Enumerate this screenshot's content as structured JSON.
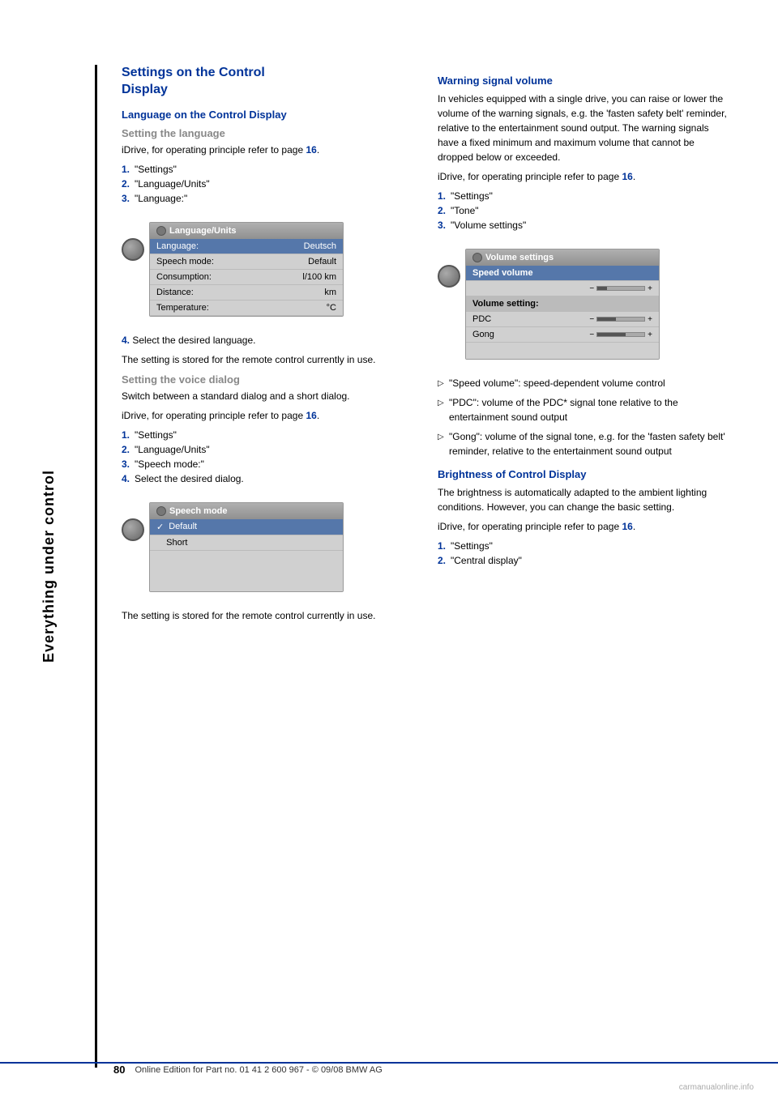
{
  "sidebar": {
    "text": "Everything under control"
  },
  "left_column": {
    "section_title_line1": "Settings on the Control",
    "section_title_line2": "Display",
    "subsection_language": "Language on the Control Display",
    "sub_setting_language": "Setting the language",
    "idrive_ref_1": "iDrive, for operating principle refer to page ",
    "idrive_ref_page_1": "16",
    "idrive_ref_1_suffix": ".",
    "language_steps": [
      {
        "num": "1.",
        "text": "\"Settings\""
      },
      {
        "num": "2.",
        "text": "\"Language/Units\""
      },
      {
        "num": "3.",
        "text": "\"Language:\""
      }
    ],
    "step4_text": "Select the desired language.",
    "setting_stored_text": "The setting is stored for the remote control currently in use.",
    "subsection_voice": "Setting the voice dialog",
    "voice_intro": "Switch between a standard dialog and a short dialog.",
    "idrive_ref_2": "iDrive, for operating principle refer to page ",
    "idrive_ref_page_2": "16",
    "idrive_ref_2_suffix": ".",
    "voice_steps": [
      {
        "num": "1.",
        "text": "\"Settings\""
      },
      {
        "num": "2.",
        "text": "\"Language/Units\""
      },
      {
        "num": "3.",
        "text": "\"Speech mode:\""
      },
      {
        "num": "4.",
        "text": "Select the desired dialog."
      }
    ],
    "setting_stored_text2": "The setting is stored for the remote control currently in use.",
    "language_screen": {
      "title": "Language/Units",
      "rows": [
        {
          "label": "Language:",
          "value": "Deutsch",
          "highlighted": true
        },
        {
          "label": "Speech mode:",
          "value": "Default",
          "highlighted": false
        },
        {
          "label": "Consumption:",
          "value": "l/100 km",
          "highlighted": false
        },
        {
          "label": "Distance:",
          "value": "km",
          "highlighted": false
        },
        {
          "label": "Temperature:",
          "value": "°C",
          "highlighted": false
        }
      ]
    },
    "speech_screen": {
      "title": "Speech mode",
      "rows": [
        {
          "label": "Default",
          "checked": true,
          "highlighted": true
        },
        {
          "label": "Short",
          "checked": false,
          "highlighted": false
        }
      ]
    }
  },
  "right_column": {
    "section_title_warning": "Warning signal volume",
    "warning_intro": "In vehicles equipped with a single drive, you can raise or lower the volume of the warning signals, e.g. the 'fasten safety belt' reminder, relative to the entertainment sound output. The warning signals have a fixed minimum and maximum volume that cannot be dropped below or exceeded.",
    "idrive_ref_3": "iDrive, for operating principle refer to page ",
    "idrive_ref_page_3": "16",
    "idrive_ref_3_suffix": ".",
    "warning_steps": [
      {
        "num": "1.",
        "text": "\"Settings\""
      },
      {
        "num": "2.",
        "text": "\"Tone\""
      },
      {
        "num": "3.",
        "text": "\"Volume settings\""
      }
    ],
    "volume_bullets": [
      "\"Speed volume\": speed-dependent volume control",
      "\"PDC\": volume of the PDC* signal tone relative to the entertainment sound output",
      "\"Gong\": volume of the signal tone, e.g. for the 'fasten safety belt' reminder, relative to the entertainment sound output"
    ],
    "section_title_brightness": "Brightness of Control Display",
    "brightness_intro": "The brightness is automatically adapted to the ambient lighting conditions. However, you can change the basic setting.",
    "idrive_ref_4": "iDrive, for operating principle refer to page ",
    "idrive_ref_page_4": "16",
    "idrive_ref_4_suffix": ".",
    "brightness_steps": [
      {
        "num": "1.",
        "text": "\"Settings\""
      },
      {
        "num": "2.",
        "text": "\"Central display\""
      }
    ],
    "volume_screen": {
      "title": "Volume settings",
      "rows": [
        {
          "label": "Speed volume",
          "value": "",
          "type": "header"
        },
        {
          "label": "",
          "value": "",
          "type": "slider",
          "minus": "−",
          "plus": "+",
          "fill": 20
        },
        {
          "label": "Volume setting:",
          "value": "",
          "type": "subheader"
        },
        {
          "label": "PDC",
          "value": "",
          "type": "slider-row",
          "minus": "−",
          "plus": "+",
          "fill": 40
        },
        {
          "label": "Gong",
          "value": "",
          "type": "slider-row",
          "minus": "−",
          "plus": "+",
          "fill": 60
        }
      ]
    }
  },
  "footer": {
    "page_number": "80",
    "footer_text": "Online Edition for Part no. 01 41 2 600 967  -  © 09/08 BMW AG"
  }
}
